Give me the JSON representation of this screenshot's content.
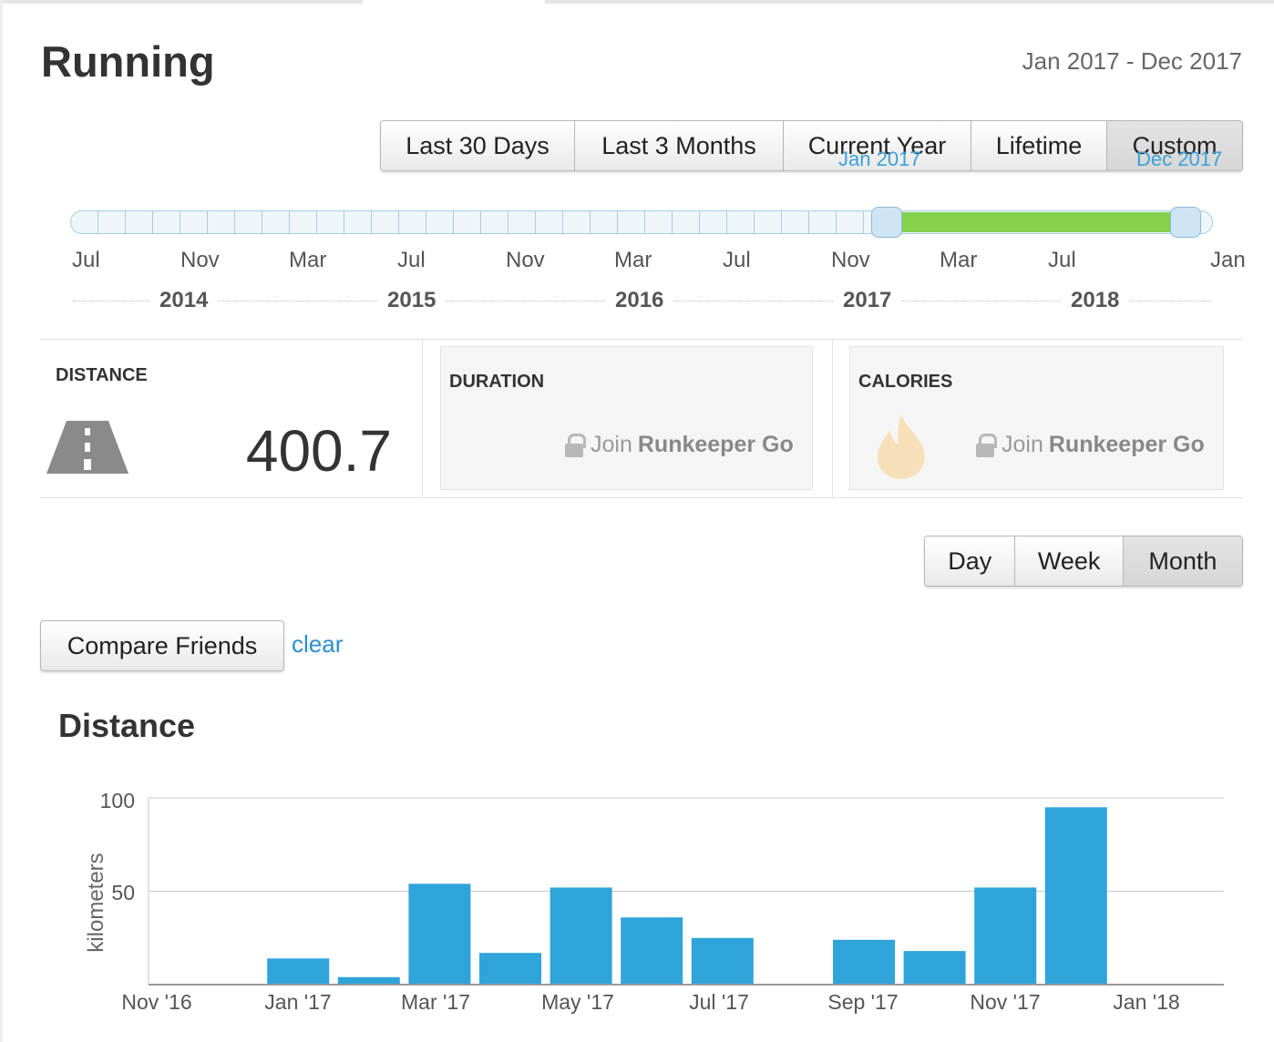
{
  "page": {
    "title": "Running",
    "date_range": "Jan 2017 - Dec 2017"
  },
  "range_buttons": [
    {
      "label": "Last 30 Days"
    },
    {
      "label": "Last 3 Months"
    },
    {
      "label": "Current Year"
    },
    {
      "label": "Lifetime"
    },
    {
      "label": "Custom"
    }
  ],
  "slider": {
    "start_label": "Jan 2017",
    "end_label": "Dec 2017",
    "months": [
      "Jul",
      "Nov",
      "Mar",
      "Jul",
      "Nov",
      "Mar",
      "Jul",
      "Nov",
      "Mar",
      "Jul",
      "Jan"
    ],
    "years": [
      "2014",
      "2015",
      "2016",
      "2017",
      "2018"
    ]
  },
  "stats": {
    "distance": {
      "label": "DISTANCE",
      "value": "400.7"
    },
    "duration": {
      "label": "DURATION",
      "join_prefix": "Join",
      "join_brand": "Runkeeper Go"
    },
    "calories": {
      "label": "CALORIES",
      "join_prefix": "Join",
      "join_brand": "Runkeeper Go"
    }
  },
  "granularity_buttons": [
    {
      "label": "Day"
    },
    {
      "label": "Week"
    },
    {
      "label": "Month"
    }
  ],
  "compare": {
    "button_label": "Compare Friends",
    "clear_label": "clear"
  },
  "colors": {
    "bar": "#2fa4da",
    "slider_fill": "#84d14e",
    "link": "#2b8fd1"
  },
  "chart_data": {
    "type": "bar",
    "title": "Distance",
    "ylabel": "kilometers",
    "ylim": [
      0,
      100
    ],
    "yticks": [
      "100",
      "50"
    ],
    "xticks": [
      "Nov '16",
      "Jan '17",
      "Mar '17",
      "May '17",
      "Jul '17",
      "Sep '17",
      "Nov '17",
      "Jan '18"
    ],
    "categories": [
      "Nov '16",
      "Dec '16",
      "Jan '17",
      "Feb '17",
      "Mar '17",
      "Apr '17",
      "May '17",
      "Jun '17",
      "Jul '17",
      "Aug '17",
      "Sep '17",
      "Oct '17",
      "Nov '17",
      "Dec '17",
      "Jan '18"
    ],
    "values": [
      0,
      0,
      14,
      4,
      54,
      17,
      52,
      36,
      25,
      0,
      24,
      18,
      52,
      95,
      0
    ],
    "grid": true
  }
}
